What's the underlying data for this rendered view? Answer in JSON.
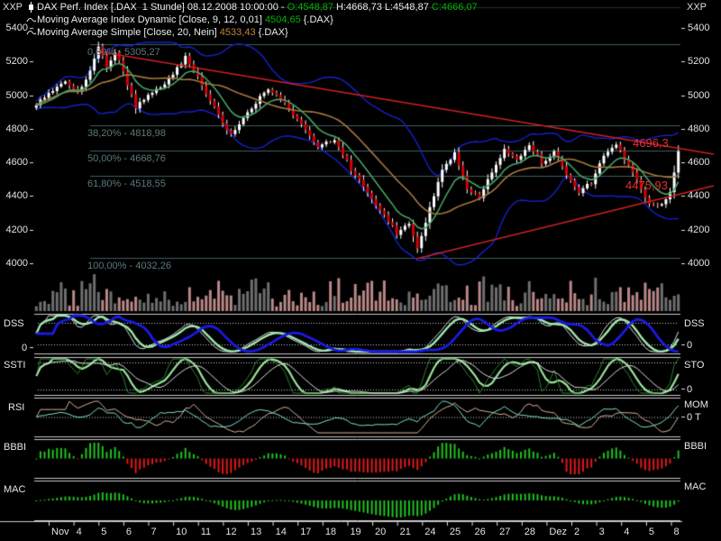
{
  "window": {
    "corner_label": "XXP"
  },
  "legend": {
    "line1": {
      "instrument": "DAX Perf. Index [.DAX  1 Stunde] 08.12.2008 10:00:00 - ",
      "open": "O:4548,87",
      "hl": " H:4668,73 L:4548,87 ",
      "close": "C:4666,07"
    },
    "line2": {
      "name": "Moving Average Index Dynamic [Close, 9, 12, 0,01] ",
      "value": "4504,65",
      "suffix": " {.DAX}"
    },
    "line3": {
      "name": "Moving Average Simple [Close, 20, Nein] ",
      "value": "4533,43",
      "suffix": " {.DAX}"
    }
  },
  "price_axis": {
    "ticks": [
      "5400",
      "5200",
      "5000",
      "4800",
      "4600",
      "4400",
      "4200",
      "4000"
    ]
  },
  "fibonacci": {
    "levels": [
      {
        "label": "0,00% - 5305,27",
        "value": 5305.27
      },
      {
        "label": "38,20% - 4818,98",
        "value": 4818.98
      },
      {
        "label": "50,00% - 4668,76",
        "value": 4668.76
      },
      {
        "label": "61,80% - 4518,55",
        "value": 4518.55
      },
      {
        "label": "100,00% - 4032,26",
        "value": 4032.26
      }
    ]
  },
  "annotations": [
    {
      "text": "4696,3",
      "color": "#e23030"
    },
    {
      "text": "4475,93",
      "color": "#e23030"
    }
  ],
  "panels": [
    {
      "left_label": "DSS",
      "right_label": "DSS",
      "left_tick": "0",
      "right_tick": "0"
    },
    {
      "left_label": "SSTI",
      "right_label": "STO",
      "right_tick": "0"
    },
    {
      "left_label": "RSI",
      "right_label": "MOM",
      "right_tick": "0 T"
    },
    {
      "left_label": "BBBI",
      "right_label": "BBBI"
    },
    {
      "left_label": "MAC",
      "right_label": "MAC"
    }
  ],
  "date_axis": {
    "labels": [
      "Nov",
      "4",
      "5",
      "6",
      "7",
      "10",
      "11",
      "12",
      "13",
      "14",
      "17",
      "18",
      "19",
      "20",
      "21",
      "24",
      "25",
      "26",
      "27",
      "28",
      "Dez",
      "2",
      "3",
      "4",
      "5",
      "8"
    ]
  },
  "chart_data": {
    "type": "candlestick",
    "title": "DAX Perf. Index",
    "symbol": ".DAX",
    "interval": "1 Stunde",
    "last_bar": {
      "time": "08.12.2008 10:00:00",
      "open": 4548.87,
      "high": 4668.73,
      "low": 4548.87,
      "close": 4666.07
    },
    "ylim": [
      3960,
      5470
    ],
    "overlays": [
      {
        "name": "Moving Average Index Dynamic",
        "params": "Close, 9, 12, 0,01",
        "value": 4504.65,
        "color": "#44a364"
      },
      {
        "name": "Moving Average Simple",
        "params": "Close, 20, Nein",
        "value": 4533.43,
        "color": "#a67a3e"
      },
      {
        "name": "band-envelope",
        "color": "#1522cc"
      }
    ],
    "trendlines": [
      {
        "direction": "descending",
        "value_label": "4696,3"
      },
      {
        "direction": "ascending",
        "value_label": "4475,93"
      }
    ],
    "sub_panel_names": [
      "DSS",
      "STO",
      "MOM",
      "BBBI",
      "MAC"
    ],
    "price_anchors": {
      "count": 156,
      "candles_per_day": 6,
      "points": [
        [
          0,
          4940
        ],
        [
          4,
          5030
        ],
        [
          7,
          5070
        ],
        [
          10,
          5010
        ],
        [
          13,
          5150
        ],
        [
          15,
          5290
        ],
        [
          17,
          5170
        ],
        [
          19,
          5260
        ],
        [
          21,
          5130
        ],
        [
          24,
          4930
        ],
        [
          28,
          5010
        ],
        [
          33,
          5120
        ],
        [
          36,
          5230
        ],
        [
          40,
          5060
        ],
        [
          44,
          4880
        ],
        [
          47,
          4760
        ],
        [
          51,
          4900
        ],
        [
          56,
          5040
        ],
        [
          60,
          4950
        ],
        [
          64,
          4820
        ],
        [
          68,
          4700
        ],
        [
          72,
          4740
        ],
        [
          76,
          4560
        ],
        [
          80,
          4420
        ],
        [
          84,
          4280
        ],
        [
          87,
          4180
        ],
        [
          90,
          4230
        ],
        [
          92,
          4080
        ],
        [
          95,
          4330
        ],
        [
          98,
          4560
        ],
        [
          101,
          4650
        ],
        [
          104,
          4450
        ],
        [
          107,
          4390
        ],
        [
          110,
          4540
        ],
        [
          113,
          4680
        ],
        [
          116,
          4620
        ],
        [
          119,
          4710
        ],
        [
          122,
          4600
        ],
        [
          125,
          4660
        ],
        [
          128,
          4520
        ],
        [
          131,
          4420
        ],
        [
          134,
          4480
        ],
        [
          137,
          4640
        ],
        [
          140,
          4710
        ],
        [
          143,
          4580
        ],
        [
          146,
          4440
        ],
        [
          148,
          4360
        ],
        [
          151,
          4340
        ],
        [
          153,
          4430
        ],
        [
          155,
          4666
        ]
      ]
    }
  }
}
